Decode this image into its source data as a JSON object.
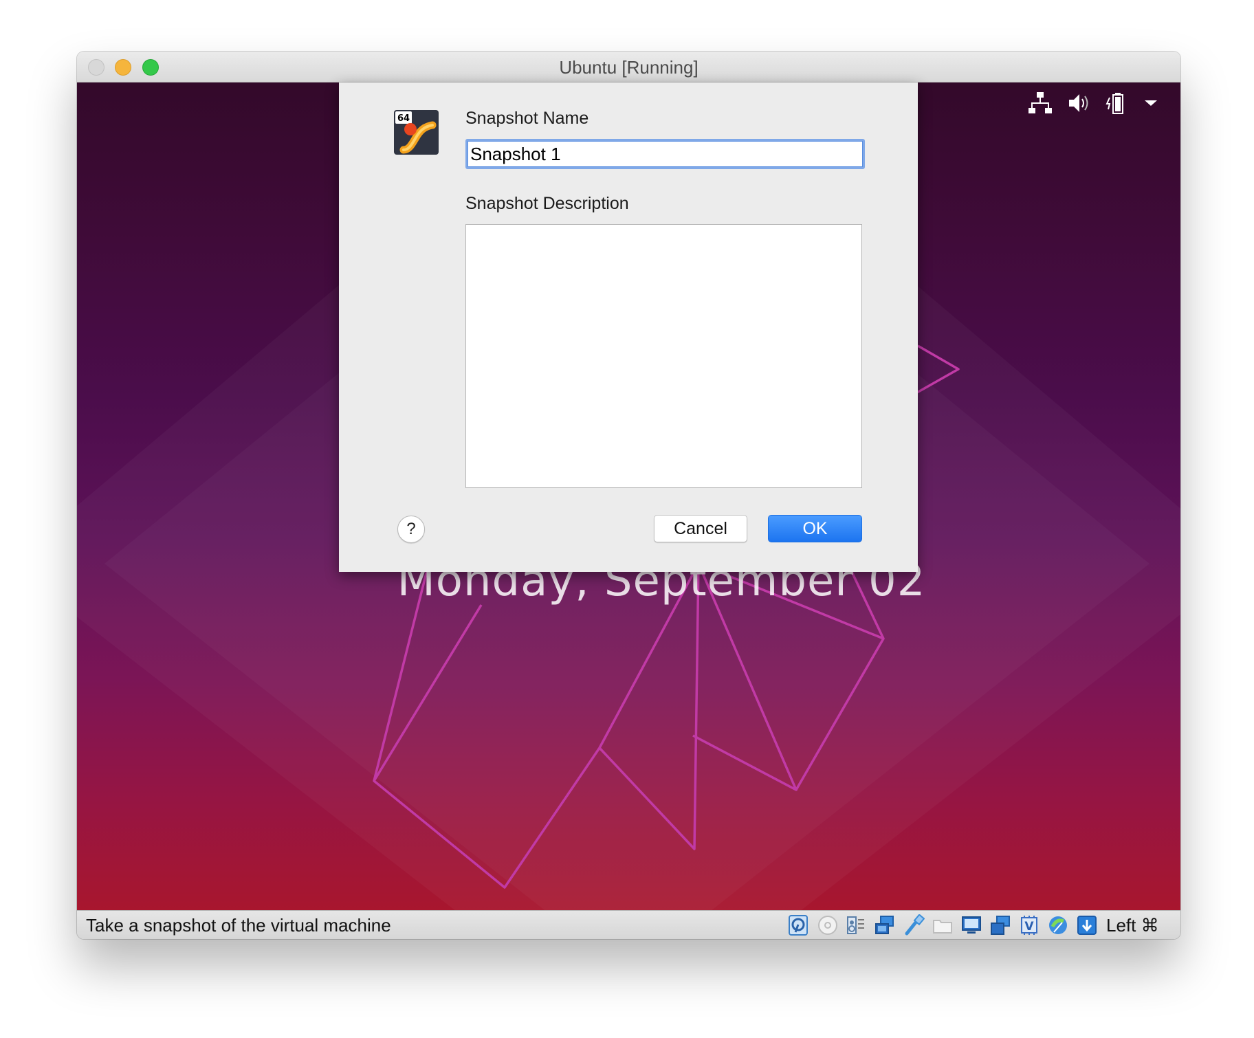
{
  "window": {
    "title": "Ubuntu [Running]"
  },
  "vm_screen": {
    "date_text": "Monday, September 02"
  },
  "tray_icons": [
    "network-icon",
    "volume-icon",
    "battery-icon",
    "dropdown-arrow-icon"
  ],
  "dialog": {
    "snapshot_name_label": "Snapshot Name",
    "snapshot_name_value": "Snapshot 1",
    "snapshot_description_label": "Snapshot Description",
    "snapshot_description_value": "",
    "help_label": "?",
    "cancel_label": "Cancel",
    "ok_label": "OK",
    "ok_color": "#1c74f0",
    "icon": "virtualbox-64-icon"
  },
  "statusbar": {
    "message": "Take a snapshot of the virtual machine",
    "host_key": "Left ⌘",
    "icons": [
      "hard-disk-icon",
      "optical-drive-icon",
      "audio-icon",
      "network-adapters-icon",
      "usb-icon",
      "shared-folders-icon",
      "display-icon",
      "recording-icon",
      "cpu-virtualization-icon",
      "mouse-integration-icon",
      "host-key-icon"
    ]
  }
}
